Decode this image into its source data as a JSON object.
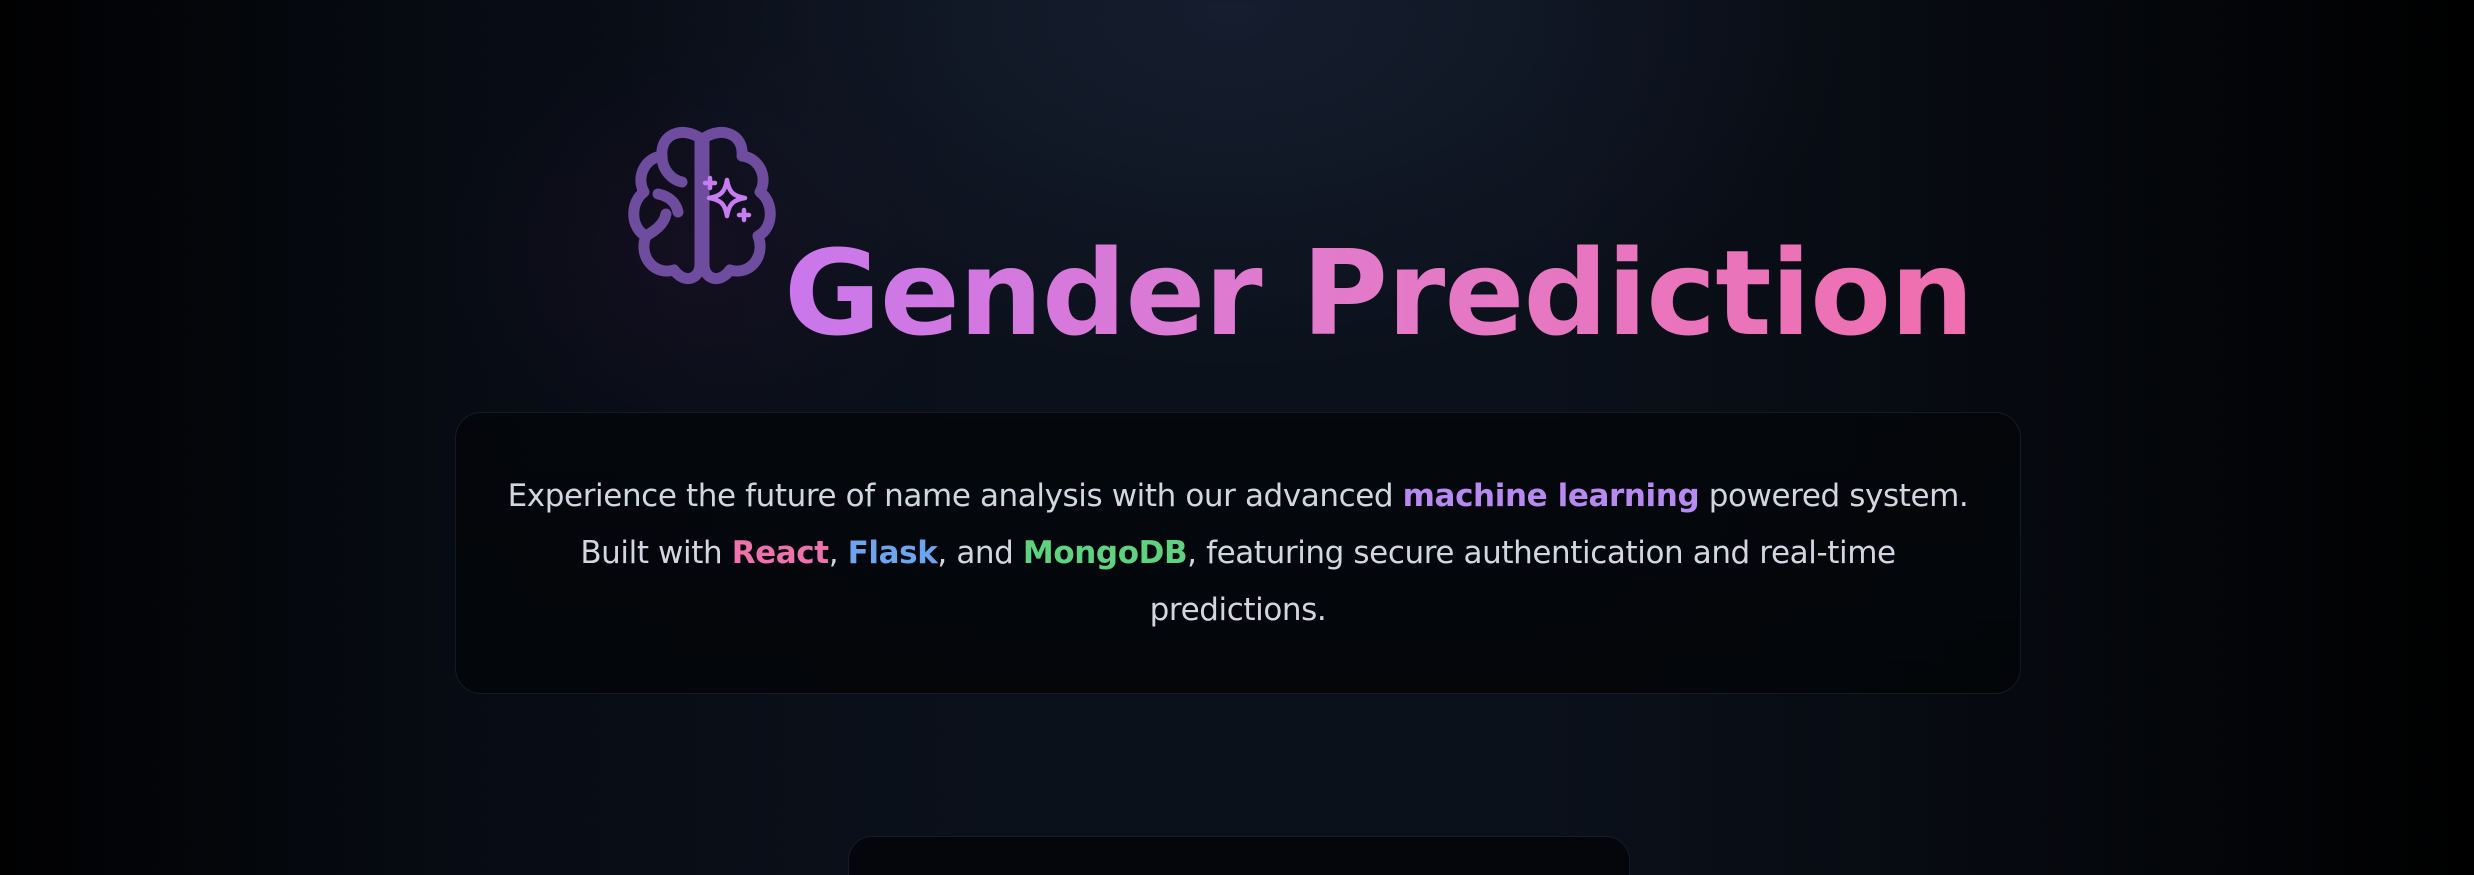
{
  "hero": {
    "icon": "brain-sparkle-icon",
    "title": "Gender Prediction"
  },
  "description": {
    "part1": "Experience the future of name analysis with our advanced ",
    "highlight1": "machine learning",
    "part2": " powered system. Built with ",
    "tech1": "React",
    "sep1": ", ",
    "tech2": "Flask",
    "sep2": ", and ",
    "tech3": "MongoDB",
    "part3": ", featuring secure authentication and real-time predictions."
  },
  "colors": {
    "title_gradient_start": "#c977ec",
    "title_gradient_end": "#ef6faf",
    "icon": "#6e4c9e",
    "sparkle": "#c77cf0",
    "machine_learning": "#b889f0",
    "react": "#ee73ad",
    "flask": "#6ea4ec",
    "mongodb": "#5ed27e"
  }
}
